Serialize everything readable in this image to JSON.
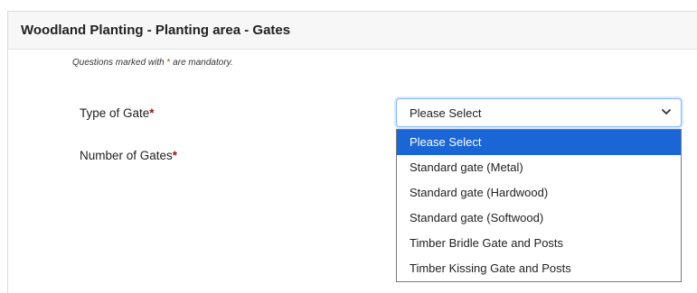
{
  "panel": {
    "title": "Woodland Planting - Planting area - Gates"
  },
  "form": {
    "note_prefix": "Questions marked with ",
    "note_star": "*",
    "note_suffix": " are mandatory.",
    "type_of_gate_label": "Type of Gate",
    "number_of_gates_label": "Number of Gates",
    "required_marker": "*",
    "type_of_gate_select": {
      "value": "Please Select",
      "options": [
        "Please Select",
        "Standard gate (Metal)",
        "Standard gate (Hardwood)",
        "Standard gate (Softwood)",
        "Timber Bridle Gate and Posts",
        "Timber Kissing Gate and Posts"
      ],
      "highlighted_index": 0
    }
  },
  "colors": {
    "highlight": "#1a66d6",
    "required_star": "#8b1a1a"
  },
  "icons": {
    "select_chevron": "chevron-down-icon"
  }
}
